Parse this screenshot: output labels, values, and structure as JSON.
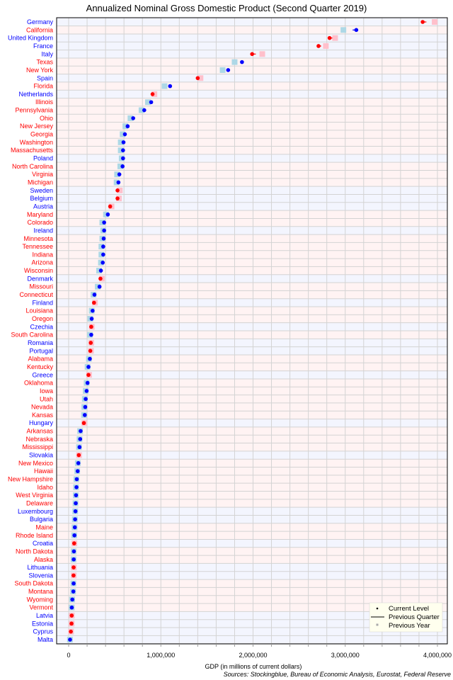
{
  "chart_data": {
    "type": "scatter",
    "title": "Annualized Nominal Gross Domestic Product (Second Quarter 2019)",
    "xlabel": "GDP (in millions of current dollars)",
    "ylabel": "",
    "source": "Sources: Stockingblue, Bureau of Economic Analysis, Eurostat, Federal Reserve",
    "xlim": [
      0,
      4000000
    ],
    "xticks": [
      0,
      1000000,
      2000000,
      3000000,
      4000000
    ],
    "xtick_labels": [
      "0",
      "1,000,000",
      "2,000,000",
      "3,000,000",
      "4,000,000"
    ],
    "grid": true,
    "legend": {
      "position": "bottom-right",
      "entries": [
        "Current Level",
        "Previous Quarter",
        "Previous Year"
      ]
    },
    "colors": {
      "country_label": "#0000ff",
      "state_label": "#ff0000",
      "increase_dot": "#0000ff",
      "decrease_dot": "#ff0000",
      "increase_prev_year": "#add8e6",
      "decrease_prev_year": "#ffc0cb",
      "country_row_bg": "#f3f5fe",
      "state_row_bg": "#fff3f3",
      "grid": "#d3d3d3",
      "legend_bg": "#ffffee"
    },
    "rows": [
      {
        "name": "Germany",
        "kind": "country",
        "current": 3840000,
        "prev_quarter": 3880000,
        "prev_year": 3970000
      },
      {
        "name": "California",
        "kind": "state",
        "current": 3120000,
        "prev_quarter": 3080000,
        "prev_year": 2980000
      },
      {
        "name": "United Kingdom",
        "kind": "country",
        "current": 2830000,
        "prev_quarter": 2860000,
        "prev_year": 2890000
      },
      {
        "name": "France",
        "kind": "country",
        "current": 2710000,
        "prev_quarter": 2740000,
        "prev_year": 2790000
      },
      {
        "name": "Italy",
        "kind": "country",
        "current": 1990000,
        "prev_quarter": 2030000,
        "prev_year": 2100000
      },
      {
        "name": "Texas",
        "kind": "state",
        "current": 1880000,
        "prev_quarter": 1870000,
        "prev_year": 1800000
      },
      {
        "name": "New York",
        "kind": "state",
        "current": 1730000,
        "prev_quarter": 1720000,
        "prev_year": 1670000
      },
      {
        "name": "Spain",
        "kind": "country",
        "current": 1400000,
        "prev_quarter": 1410000,
        "prev_year": 1430000
      },
      {
        "name": "Florida",
        "kind": "state",
        "current": 1100000,
        "prev_quarter": 1090000,
        "prev_year": 1040000
      },
      {
        "name": "Netherlands",
        "kind": "country",
        "current": 910000,
        "prev_quarter": 915000,
        "prev_year": 930000
      },
      {
        "name": "Illinois",
        "kind": "state",
        "current": 895000,
        "prev_quarter": 890000,
        "prev_year": 860000
      },
      {
        "name": "Pennsylvania",
        "kind": "state",
        "current": 820000,
        "prev_quarter": 815000,
        "prev_year": 790000
      },
      {
        "name": "Ohio",
        "kind": "state",
        "current": 700000,
        "prev_quarter": 695000,
        "prev_year": 670000
      },
      {
        "name": "New Jersey",
        "kind": "state",
        "current": 640000,
        "prev_quarter": 635000,
        "prev_year": 615000
      },
      {
        "name": "Georgia",
        "kind": "state",
        "current": 610000,
        "prev_quarter": 605000,
        "prev_year": 585000
      },
      {
        "name": "Washington",
        "kind": "state",
        "current": 595000,
        "prev_quarter": 590000,
        "prev_year": 565000
      },
      {
        "name": "Massachusetts",
        "kind": "state",
        "current": 590000,
        "prev_quarter": 585000,
        "prev_year": 565000
      },
      {
        "name": "Poland",
        "kind": "country",
        "current": 590000,
        "prev_quarter": 588000,
        "prev_year": 575000
      },
      {
        "name": "North Carolina",
        "kind": "state",
        "current": 585000,
        "prev_quarter": 580000,
        "prev_year": 560000
      },
      {
        "name": "Virginia",
        "kind": "state",
        "current": 550000,
        "prev_quarter": 545000,
        "prev_year": 525000
      },
      {
        "name": "Michigan",
        "kind": "state",
        "current": 540000,
        "prev_quarter": 535000,
        "prev_year": 520000
      },
      {
        "name": "Sweden",
        "kind": "country",
        "current": 530000,
        "prev_quarter": 535000,
        "prev_year": 555000
      },
      {
        "name": "Belgium",
        "kind": "country",
        "current": 530000,
        "prev_quarter": 532000,
        "prev_year": 545000
      },
      {
        "name": "Austria",
        "kind": "country",
        "current": 450000,
        "prev_quarter": 452000,
        "prev_year": 465000
      },
      {
        "name": "Maryland",
        "kind": "state",
        "current": 425000,
        "prev_quarter": 422000,
        "prev_year": 405000
      },
      {
        "name": "Colorado",
        "kind": "state",
        "current": 385000,
        "prev_quarter": 382000,
        "prev_year": 365000
      },
      {
        "name": "Ireland",
        "kind": "country",
        "current": 385000,
        "prev_quarter": 383000,
        "prev_year": 375000
      },
      {
        "name": "Minnesota",
        "kind": "state",
        "current": 380000,
        "prev_quarter": 377000,
        "prev_year": 365000
      },
      {
        "name": "Tennessee",
        "kind": "state",
        "current": 375000,
        "prev_quarter": 372000,
        "prev_year": 355000
      },
      {
        "name": "Indiana",
        "kind": "state",
        "current": 375000,
        "prev_quarter": 372000,
        "prev_year": 355000
      },
      {
        "name": "Arizona",
        "kind": "state",
        "current": 370000,
        "prev_quarter": 367000,
        "prev_year": 350000
      },
      {
        "name": "Wisconsin",
        "kind": "state",
        "current": 350000,
        "prev_quarter": 348000,
        "prev_year": 330000
      },
      {
        "name": "Denmark",
        "kind": "country",
        "current": 345000,
        "prev_quarter": 347000,
        "prev_year": 360000
      },
      {
        "name": "Missouri",
        "kind": "state",
        "current": 335000,
        "prev_quarter": 333000,
        "prev_year": 315000
      },
      {
        "name": "Connecticut",
        "kind": "state",
        "current": 280000,
        "prev_quarter": 278000,
        "prev_year": 270000
      },
      {
        "name": "Finland",
        "kind": "country",
        "current": 275000,
        "prev_quarter": 277000,
        "prev_year": 285000
      },
      {
        "name": "Louisiana",
        "kind": "state",
        "current": 260000,
        "prev_quarter": 258000,
        "prev_year": 250000
      },
      {
        "name": "Oregon",
        "kind": "state",
        "current": 250000,
        "prev_quarter": 248000,
        "prev_year": 235000
      },
      {
        "name": "Czechia",
        "kind": "country",
        "current": 245000,
        "prev_quarter": 246000,
        "prev_year": 250000
      },
      {
        "name": "South Carolina",
        "kind": "state",
        "current": 245000,
        "prev_quarter": 243000,
        "prev_year": 232000
      },
      {
        "name": "Romania",
        "kind": "country",
        "current": 240000,
        "prev_quarter": 241000,
        "prev_year": 245000
      },
      {
        "name": "Portugal",
        "kind": "country",
        "current": 235000,
        "prev_quarter": 236000,
        "prev_year": 242000
      },
      {
        "name": "Alabama",
        "kind": "state",
        "current": 230000,
        "prev_quarter": 228000,
        "prev_year": 220000
      },
      {
        "name": "Kentucky",
        "kind": "state",
        "current": 215000,
        "prev_quarter": 214000,
        "prev_year": 205000
      },
      {
        "name": "Greece",
        "kind": "country",
        "current": 215000,
        "prev_quarter": 216000,
        "prev_year": 222000
      },
      {
        "name": "Oklahoma",
        "kind": "state",
        "current": 205000,
        "prev_quarter": 203000,
        "prev_year": 195000
      },
      {
        "name": "Iowa",
        "kind": "state",
        "current": 195000,
        "prev_quarter": 194000,
        "prev_year": 185000
      },
      {
        "name": "Utah",
        "kind": "state",
        "current": 185000,
        "prev_quarter": 184000,
        "prev_year": 175000
      },
      {
        "name": "Nevada",
        "kind": "state",
        "current": 180000,
        "prev_quarter": 179000,
        "prev_year": 170000
      },
      {
        "name": "Kansas",
        "kind": "state",
        "current": 175000,
        "prev_quarter": 174000,
        "prev_year": 167000
      },
      {
        "name": "Hungary",
        "kind": "country",
        "current": 165000,
        "prev_quarter": 166000,
        "prev_year": 170000
      },
      {
        "name": "Arkansas",
        "kind": "state",
        "current": 130000,
        "prev_quarter": 129000,
        "prev_year": 124000
      },
      {
        "name": "Nebraska",
        "kind": "state",
        "current": 125000,
        "prev_quarter": 124000,
        "prev_year": 118000
      },
      {
        "name": "Mississippi",
        "kind": "state",
        "current": 118000,
        "prev_quarter": 117000,
        "prev_year": 112000
      },
      {
        "name": "Slovakia",
        "kind": "country",
        "current": 110000,
        "prev_quarter": 111000,
        "prev_year": 113000
      },
      {
        "name": "New Mexico",
        "kind": "state",
        "current": 105000,
        "prev_quarter": 104000,
        "prev_year": 99000
      },
      {
        "name": "Hawaii",
        "kind": "state",
        "current": 98000,
        "prev_quarter": 97000,
        "prev_year": 93000
      },
      {
        "name": "New Hampshire",
        "kind": "state",
        "current": 88000,
        "prev_quarter": 87000,
        "prev_year": 84000
      },
      {
        "name": "Idaho",
        "kind": "state",
        "current": 85000,
        "prev_quarter": 84000,
        "prev_year": 80000
      },
      {
        "name": "West Virginia",
        "kind": "state",
        "current": 80000,
        "prev_quarter": 79500,
        "prev_year": 77000
      },
      {
        "name": "Delaware",
        "kind": "state",
        "current": 77000,
        "prev_quarter": 76500,
        "prev_year": 74000
      },
      {
        "name": "Luxembourg",
        "kind": "country",
        "current": 74000,
        "prev_quarter": 73500,
        "prev_year": 71000
      },
      {
        "name": "Bulgaria",
        "kind": "country",
        "current": 70000,
        "prev_quarter": 69500,
        "prev_year": 67000
      },
      {
        "name": "Maine",
        "kind": "state",
        "current": 67000,
        "prev_quarter": 66500,
        "prev_year": 64000
      },
      {
        "name": "Rhode Island",
        "kind": "state",
        "current": 63000,
        "prev_quarter": 62500,
        "prev_year": 60000
      },
      {
        "name": "Croatia",
        "kind": "country",
        "current": 60000,
        "prev_quarter": 60500,
        "prev_year": 62000
      },
      {
        "name": "North Dakota",
        "kind": "state",
        "current": 57000,
        "prev_quarter": 56500,
        "prev_year": 54000
      },
      {
        "name": "Alaska",
        "kind": "state",
        "current": 55000,
        "prev_quarter": 54500,
        "prev_year": 53000
      },
      {
        "name": "Lithuania",
        "kind": "country",
        "current": 54000,
        "prev_quarter": 54500,
        "prev_year": 56000
      },
      {
        "name": "Slovenia",
        "kind": "country",
        "current": 53000,
        "prev_quarter": 53500,
        "prev_year": 55000
      },
      {
        "name": "South Dakota",
        "kind": "state",
        "current": 54000,
        "prev_quarter": 53500,
        "prev_year": 51000
      },
      {
        "name": "Montana",
        "kind": "state",
        "current": 51000,
        "prev_quarter": 50500,
        "prev_year": 48000
      },
      {
        "name": "Wyoming",
        "kind": "state",
        "current": 40000,
        "prev_quarter": 39800,
        "prev_year": 38000
      },
      {
        "name": "Vermont",
        "kind": "state",
        "current": 34000,
        "prev_quarter": 33800,
        "prev_year": 33000
      },
      {
        "name": "Latvia",
        "kind": "country",
        "current": 33000,
        "prev_quarter": 33200,
        "prev_year": 34000
      },
      {
        "name": "Estonia",
        "kind": "country",
        "current": 31000,
        "prev_quarter": 31200,
        "prev_year": 32000
      },
      {
        "name": "Cyprus",
        "kind": "country",
        "current": 24000,
        "prev_quarter": 24200,
        "prev_year": 25500
      },
      {
        "name": "Malta",
        "kind": "country",
        "current": 15000,
        "prev_quarter": 14900,
        "prev_year": 14000
      }
    ]
  }
}
